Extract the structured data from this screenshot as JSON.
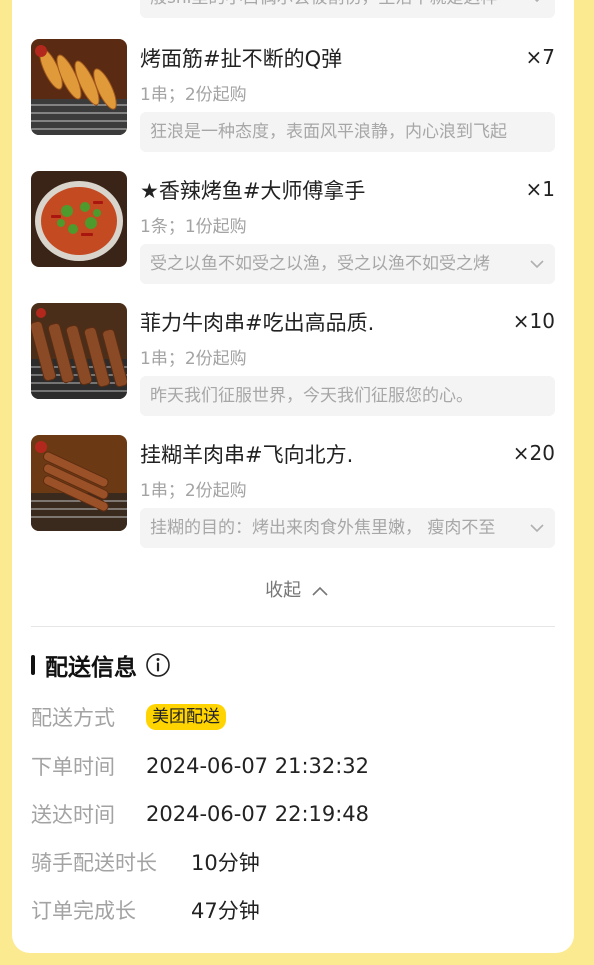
{
  "items": [
    {
      "name": "烤面筋#扯不断的Q弹",
      "quantity": "×7",
      "spec": "1串；2份起购",
      "note": "狂浪是一种态度，表面风平浪静，内心浪到飞起",
      "thumb_icon": "grilled-gluten-image",
      "expandable": false
    },
    {
      "name": "★香辣烤鱼#大师傅拿手",
      "quantity": "×1",
      "spec": "1条；1份起购",
      "note": "受之以鱼不如受之以渔，受之以渔不如受之烤",
      "thumb_icon": "grilled-fish-image",
      "expandable": true
    },
    {
      "name": "菲力牛肉串#吃出高品质.",
      "quantity": "×10",
      "spec": "1串；2份起购",
      "note": "昨天我们征服世界，今天我们征服您的心。",
      "thumb_icon": "beef-skewer-image",
      "expandable": false
    },
    {
      "name": "挂糊羊肉串#飞向北方.",
      "quantity": "×20",
      "spec": "1串；2份起购",
      "note": "挂糊的目的：烤出来肉食外焦里嫩， 瘦肉不至",
      "thumb_icon": "lamb-skewer-image",
      "expandable": true
    }
  ],
  "top_note_partial": "般shi里的小白偶尔会被割伤，生活不就是这样",
  "collapse_label": "收起",
  "delivery": {
    "title": "配送信息",
    "method_label": "配送方式",
    "method_value": "美团配送",
    "order_time_label": "下单时间",
    "order_time_value": "2024-06-07 21:32:32",
    "arrival_time_label": "送达时间",
    "arrival_time_value": "2024-06-07 22:19:48",
    "rider_duration_label": "骑手配送时长",
    "rider_duration_value": "10分钟",
    "order_duration_label": "订单完成长",
    "order_duration_value": "47分钟"
  },
  "colors": {
    "background": "#fbea8f",
    "badge": "#ffd400",
    "muted_text": "#a3a3a3"
  }
}
